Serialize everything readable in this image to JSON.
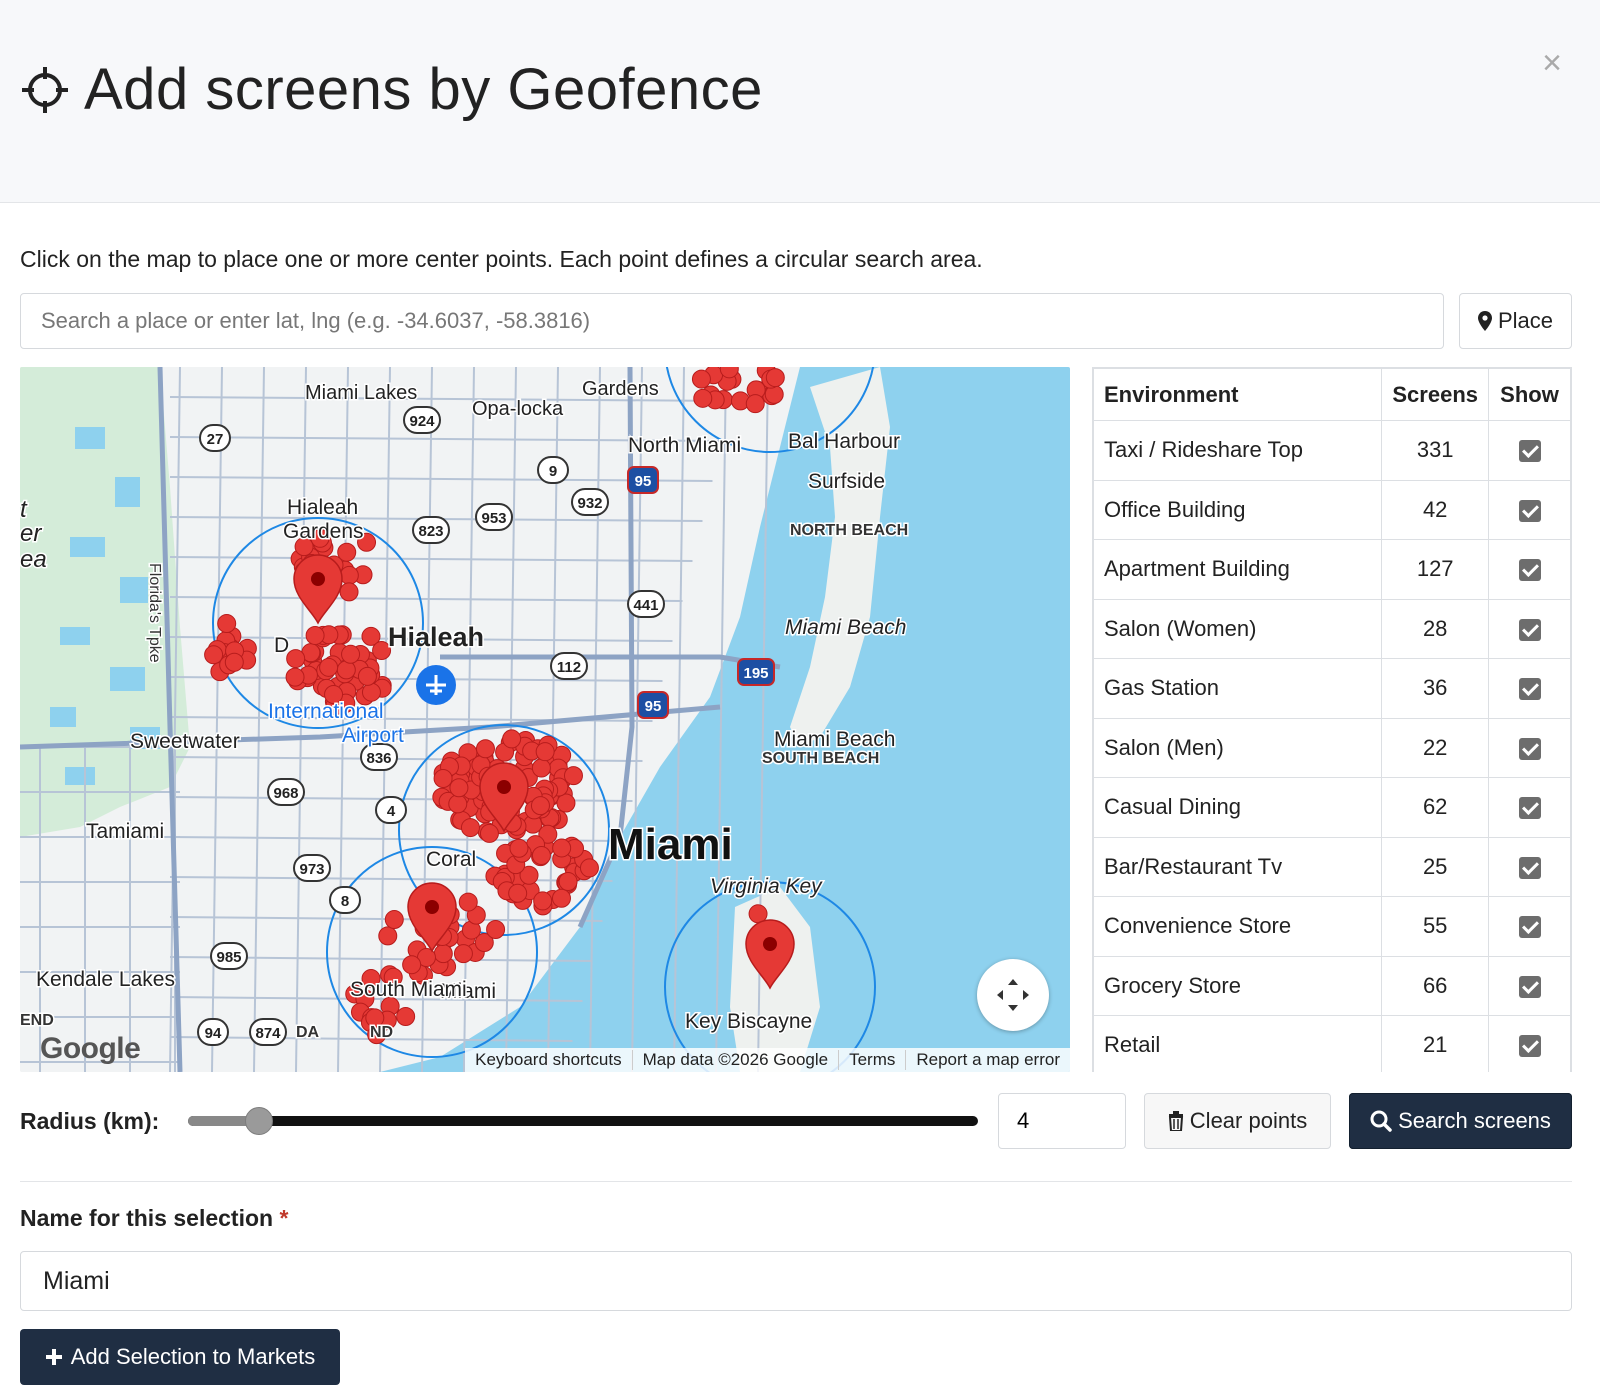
{
  "header": {
    "title": "Add screens by Geofence",
    "title_icon": "crosshair-icon",
    "close_label": "×"
  },
  "instruction": "Click on the map to place one or more center points. Each point defines a circular search area.",
  "search": {
    "placeholder": "Search a place or enter lat, lng (e.g. -34.6037, -58.3816)",
    "value": "",
    "place_button": "Place"
  },
  "map": {
    "labels": [
      "Miami Lakes",
      "Opa-locka",
      "Gardens",
      "North Miami",
      "Bal Harbour",
      "Surfside",
      "Hialeah",
      "Gardens",
      "NORTH BEACH",
      "Hialeah",
      "Miami Beach",
      "Miami",
      "International",
      "Airport",
      "Sweetwater",
      "Miami Beach",
      "SOUTH BEACH",
      "Tamiami",
      "Coral",
      "Miami",
      "Virginia Key",
      "Kendale Lakes",
      "South Miami",
      "Key Biscayne",
      "Florida's Tpke",
      "D",
      "t",
      "er",
      "ea",
      "END",
      "DA",
      "ND"
    ],
    "shields": [
      "27",
      "924",
      "9",
      "932",
      "95",
      "953",
      "823",
      "441",
      "112",
      "195",
      "95",
      "836",
      "968",
      "4",
      "973",
      "8",
      "985",
      "94",
      "874"
    ],
    "google_logo": "Google",
    "attribution": [
      "Keyboard shortcuts",
      "Map data ©2026 Google",
      "Terms",
      "Report a map error"
    ]
  },
  "environment_table": {
    "headers": [
      "Environment",
      "Screens",
      "Show"
    ],
    "rows": [
      {
        "name": "Taxi / Rideshare Top",
        "screens": "331",
        "show": true
      },
      {
        "name": "Office Building",
        "screens": "42",
        "show": true
      },
      {
        "name": "Apartment Building",
        "screens": "127",
        "show": true
      },
      {
        "name": "Salon (Women)",
        "screens": "28",
        "show": true
      },
      {
        "name": "Gas Station",
        "screens": "36",
        "show": true
      },
      {
        "name": "Salon (Men)",
        "screens": "22",
        "show": true
      },
      {
        "name": "Casual Dining",
        "screens": "62",
        "show": true
      },
      {
        "name": "Bar/Restaurant Tv",
        "screens": "25",
        "show": true
      },
      {
        "name": "Convenience Store",
        "screens": "55",
        "show": true
      },
      {
        "name": "Grocery Store",
        "screens": "66",
        "show": true
      },
      {
        "name": "Retail",
        "screens": "21",
        "show": true
      }
    ]
  },
  "radius": {
    "label": "Radius (km):",
    "value": "4",
    "slider_fraction": 0.09
  },
  "buttons": {
    "clear": "Clear points",
    "search": "Search screens",
    "add": "Add Selection to Markets"
  },
  "selection": {
    "label": "Name for this selection",
    "required_mark": "*",
    "value": "Miami"
  },
  "colors": {
    "primary_button": "#1f2e43",
    "marker": "#e53935",
    "circle": "#1e88e5",
    "water": "#8ed1ee"
  }
}
